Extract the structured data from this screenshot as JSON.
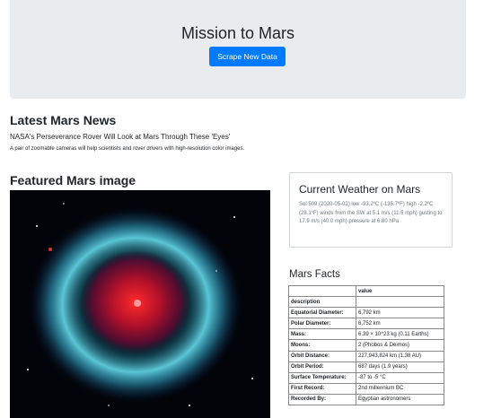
{
  "jumbotron": {
    "title": "Mission to Mars",
    "button_label": "Scrape New Data"
  },
  "news": {
    "heading": "Latest Mars News",
    "title": "NASA's Perseverance Rover Will Look at Mars Through These 'Eyes'",
    "paragraph": "A pair of zoomable cameras will help scientists and rover drivers with high-resolution color images."
  },
  "featured": {
    "heading": "Featured Mars image",
    "image_alt": "nebula-image"
  },
  "weather": {
    "heading": "Current Weather on Mars",
    "text": "Sol 509 (2020-05-02) low -93.2ºC (-135.7ºF) high -2.2ºC (28.1ºF) winds from the SW at 5.1 m/s (11.5 mph) gusting to 17.9 m/s (40.0 mph) pressure at 6.80 hPa"
  },
  "facts": {
    "heading": "Mars Facts",
    "value_header": "value",
    "description_label": "description",
    "rows": [
      {
        "k": "Equatorial Diameter:",
        "v": "6,792 km"
      },
      {
        "k": "Polar Diameter:",
        "v": "6,752 km"
      },
      {
        "k": "Mass:",
        "v": "6.39 × 10^23 kg (0.11 Earths)"
      },
      {
        "k": "Moons:",
        "v": "2 (Phobos & Deimos)"
      },
      {
        "k": "Orbit Distance:",
        "v": "227,943,824 km (1.38 AU)"
      },
      {
        "k": "Orbit Period:",
        "v": "687 days (1.9 years)"
      },
      {
        "k": "Surface Temperature:",
        "v": "-87 to -5 °C"
      },
      {
        "k": "First Record:",
        "v": "2nd millennium BC"
      },
      {
        "k": "Recorded By:",
        "v": "Egyptian astronomers"
      }
    ]
  }
}
